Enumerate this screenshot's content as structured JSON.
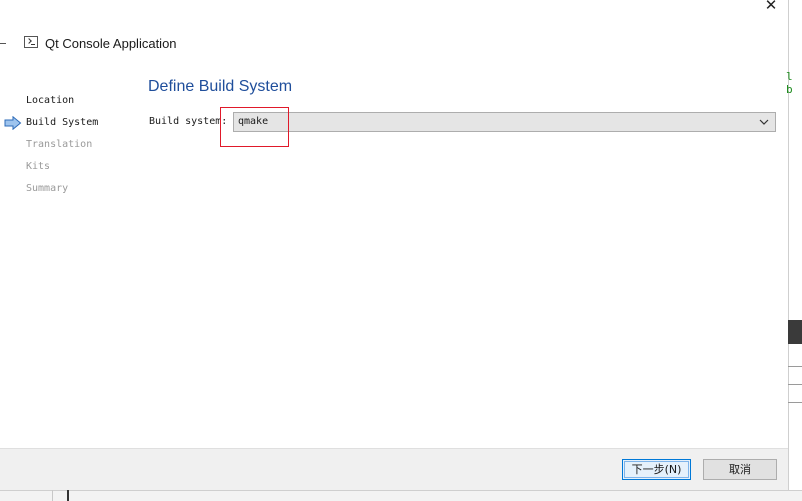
{
  "window": {
    "title": "Qt Console Application",
    "close_glyph": "✕"
  },
  "nav": {
    "items": [
      {
        "label": "Location",
        "state": "done"
      },
      {
        "label": "Build System",
        "state": "current"
      },
      {
        "label": "Translation",
        "state": "pending"
      },
      {
        "label": "Kits",
        "state": "pending"
      },
      {
        "label": "Summary",
        "state": "pending"
      }
    ]
  },
  "page": {
    "title": "Define Build System",
    "build_system_label": "Build system:",
    "build_system_value": "qmake"
  },
  "buttons": {
    "next": "下一步(N)",
    "cancel": "取消"
  },
  "background": {
    "code_snippet": "l b"
  },
  "icons": {
    "window_icon": "console-icon",
    "current_step": "arrow-right-icon",
    "dropdown": "chevron-down-icon"
  },
  "colors": {
    "accent_title": "#1f4e9b",
    "highlight": "#e0192a",
    "focus_border": "#0078d7"
  }
}
